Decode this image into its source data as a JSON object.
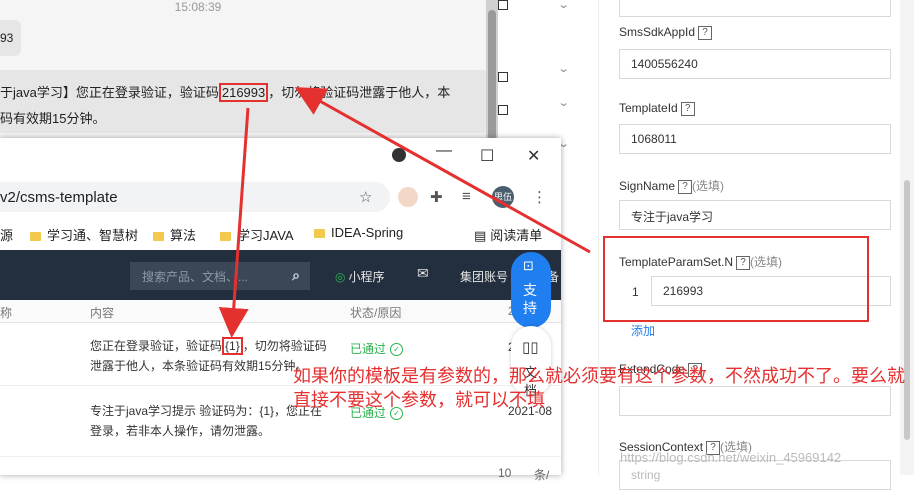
{
  "chat": {
    "time": "15:08:39",
    "bubble1_text": "93",
    "msg_line1_pre": "于java学习】您正在登录验证，验证码",
    "msg_code": "216993",
    "msg_line1_post": "，切勿将验证码泄露于他人，本",
    "msg_line2": "码有效期15分钟。"
  },
  "form": {
    "fields": [
      {
        "label": "SmsSdkAppId",
        "value": "1400556240",
        "optional": ""
      },
      {
        "label": "TemplateId",
        "value": "1068011",
        "optional": ""
      },
      {
        "label": "SignName",
        "value": "专注于java学习",
        "optional": "(选填)"
      },
      {
        "label": "TemplateParamSet.N",
        "value": "216993",
        "optional": "(选填)",
        "index": "1"
      }
    ],
    "add_link": "添加",
    "extend_label": "ExtendCode",
    "session_label": "SessionContext",
    "session_optional": "(选填)",
    "session_placeholder": "string",
    "help_glyph": "?"
  },
  "browser": {
    "url": "v2/csms-template",
    "bookmarks": [
      "源",
      "学习通、智慧树",
      "算法",
      "学习JAVA",
      "IDEA-Spring",
      "阅读清单"
    ],
    "avatar_text": "思伍",
    "search_placeholder": "搜索产品、文档、...",
    "nav_items": [
      "小程序",
      "集团账号",
      "备"
    ],
    "support_chars": [
      "支",
      "持"
    ],
    "doc_chars": [
      "文",
      "档"
    ],
    "table_headers": [
      "称",
      "内容",
      "状态/原因",
      "2"
    ],
    "rows": [
      {
        "content_pre": "您正在登录验证，验证码",
        "param": "{1}",
        "content_post": "，切勿将验证码",
        "content_line2": "泄露于他人，本条验证码有效期15分钟。",
        "status": "已通过",
        "date": "2"
      },
      {
        "content_line1": "专注于java学习提示 验证码为：{1}，您正在",
        "content_line2": "登录，若非本人操作，请勿泄露。",
        "status": "已通过",
        "date": "2021-08"
      }
    ],
    "footer_left": "10",
    "footer_right": "条/"
  },
  "annotation": {
    "text": "如果你的模板是有参数的，那么就必须要有这个参数，不然成功不了。要么就直接不要这个参数，就可以不填",
    "watermark": "https://blog.csdn.net/weixin_45969142"
  },
  "colors": {
    "annotation_red": "#e53030",
    "nav_dark": "#232f3e",
    "support_blue": "#1f7ef0",
    "status_green": "#2bb24c"
  }
}
